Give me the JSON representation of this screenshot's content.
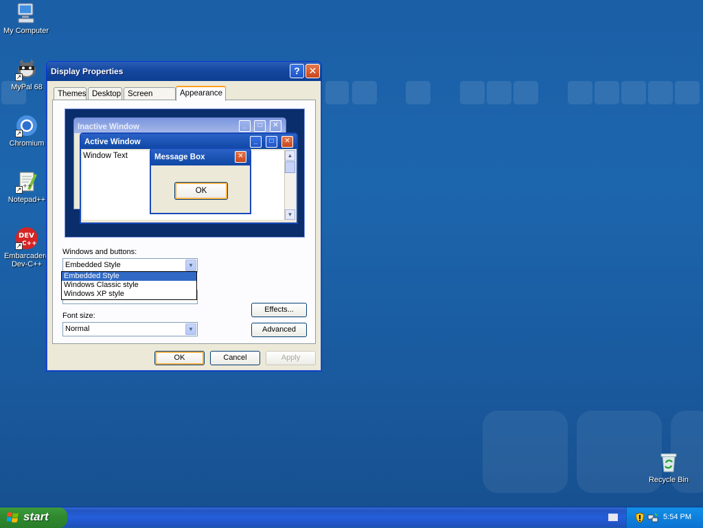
{
  "desktop": {
    "icons": [
      {
        "label": "My Computer",
        "icon": "computer-icon"
      },
      {
        "label": "MyPal 68",
        "icon": "mypal-icon"
      },
      {
        "label": "Chromium",
        "icon": "chromium-icon"
      },
      {
        "label": "Notepad++",
        "icon": "notepadpp-icon"
      },
      {
        "label": "Embarcadero Dev-C++",
        "label_line1": "Embarcadero",
        "label_line2": "Dev-C++",
        "icon": "devcpp-icon"
      },
      {
        "label": "Recycle Bin",
        "icon": "recycle-bin-icon"
      }
    ]
  },
  "window": {
    "title": "Display Properties",
    "help_glyph": "?",
    "close_glyph": "✕",
    "tabs": [
      {
        "label": "Themes",
        "active": false
      },
      {
        "label": "Desktop",
        "active": false
      },
      {
        "label": "Screen Saver",
        "active": false
      },
      {
        "label": "Appearance",
        "active": true
      }
    ],
    "preview": {
      "inactive_title": "Inactive Window",
      "active_title": "Active Window",
      "window_text": "Window Text",
      "message_title": "Message Box",
      "message_ok": "OK"
    },
    "windows_buttons_label": "Windows and buttons:",
    "windows_buttons_value": "Embedded Style",
    "windows_buttons_options": [
      "Embedded Style",
      "Windows Classic style",
      "Windows XP style"
    ],
    "font_size_label": "Font size:",
    "font_size_value": "Normal",
    "effects_button": "Effects...",
    "advanced_button": "Advanced",
    "ok_button": "OK",
    "cancel_button": "Cancel",
    "apply_button": "Apply"
  },
  "taskbar": {
    "start_label": "start",
    "clock": "5:54 PM"
  },
  "colors": {
    "desktop_bg": "#1c66ae",
    "titlebar": "#0d3f93",
    "start_green": "#2f8a2f",
    "tray_blue": "#0c72d0",
    "selection": "#316ac5"
  }
}
